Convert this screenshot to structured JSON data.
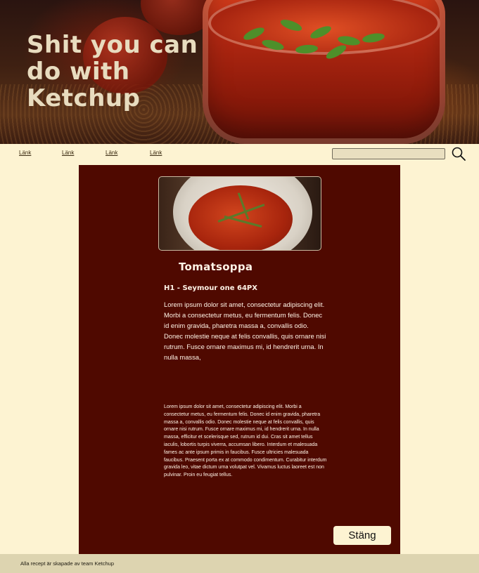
{
  "hero": {
    "title": "Shit you can do with Ketchup"
  },
  "nav": {
    "links": [
      "Länk",
      "Länk",
      "Länk",
      "Länk"
    ],
    "search": {
      "value": "",
      "placeholder": ""
    },
    "search_icon": "search-icon"
  },
  "recipe": {
    "title": "Tomatsoppa",
    "subtitle": "H1 - Seymour one 64PX",
    "intro": "Lorem ipsum dolor sit amet, consectetur adipiscing elit. Morbi a consectetur metus, eu fermentum felis. Donec id enim gravida, pharetra massa a, convallis odio. Donec molestie neque at felis convallis, quis ornare nisi rutrum. Fusce ornare maximus mi, id hendrerit urna. In nulla massa,",
    "body": "Lorem ipsum dolor sit amet, consectetur adipiscing elit. Morbi a consectetur metus, eu fermentum felis. Donec id enim gravida, pharetra massa a, convallis odio. Donec molestie neque at felis convallis, quis ornare nisi rutrum. Fusce ornare maximus mi, id hendrerit urna. In nulla massa, efficitur et scelerisque sed, rutrum id dui. Cras sit amet tellus iaculis, lobortis turpis viverra, accumsan libero. Interdum et malesuada fames ac ante ipsum primis in faucibus. Fusce ultricies malesuada faucibus. Praesent porta ex at commodo condimentum. Curabitur interdum gravida leo, vitae dictum urna volutpat vel. Vivamus luctus laoreet est non pulvinar. Proin eu feugiat tellus.",
    "close_label": "Stäng"
  },
  "footer": {
    "text": "Alla recept är skapade av team Ketchup"
  },
  "colors": {
    "page_bg": "#fdf3d2",
    "card_bg": "#4f0900",
    "footer_bg": "#ddd4b0",
    "hero_text": "#e8dcbf"
  }
}
